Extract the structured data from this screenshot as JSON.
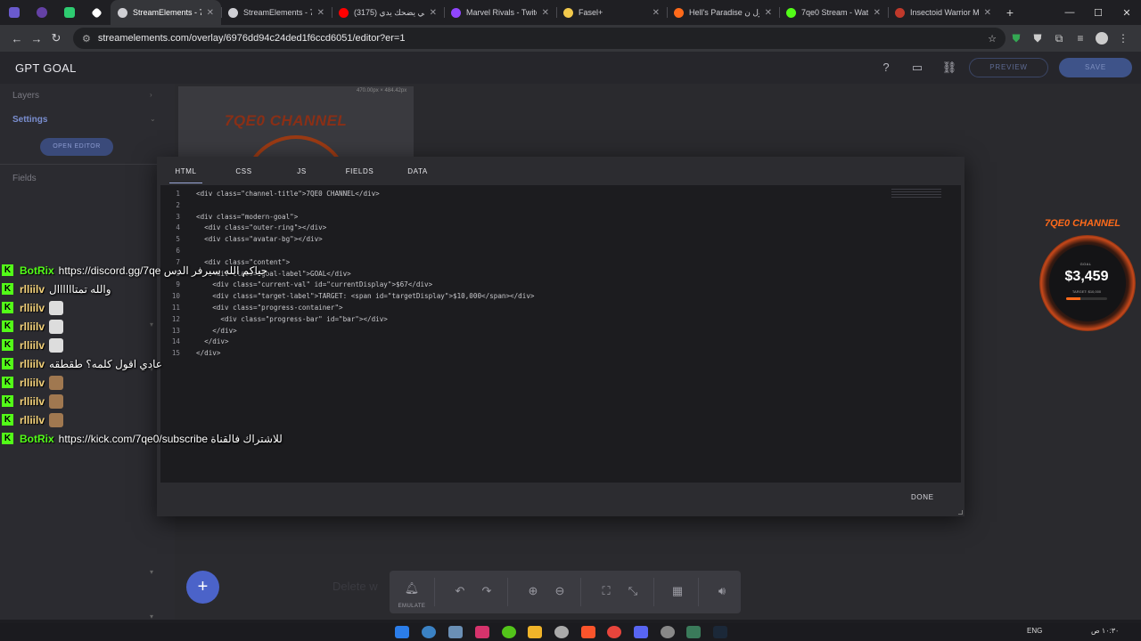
{
  "browser": {
    "tabs": [
      {
        "label": "StreamElements - 7q",
        "active": true,
        "color": "#cfcfd4"
      },
      {
        "label": "StreamElements - 7q",
        "active": false,
        "color": "#cfcfd4"
      },
      {
        "label": "(3175) الي يضحك يدي",
        "active": false,
        "color": "#ff0000"
      },
      {
        "label": "Marvel Rivals - Twitch",
        "active": false,
        "color": "#9146ff"
      },
      {
        "label": "Fasel+",
        "active": false,
        "color": "#f2c94c"
      },
      {
        "label": "Hell's Paradise رول ن",
        "active": false,
        "color": "#ff6a1a"
      },
      {
        "label": "7qe0 Stream - Watch",
        "active": false,
        "color": "#53fc18"
      },
      {
        "label": "Insectoid Warrior Me",
        "active": false,
        "color": "#c0392b"
      }
    ],
    "url": "streamelements.com/overlay/6976dd94c24ded1f6ccd6051/editor?er=1"
  },
  "header": {
    "title": "GPT GOAL",
    "preview_label": "PREVIEW",
    "save_label": "SAVE"
  },
  "left_panel": {
    "layers_label": "Layers",
    "settings_label": "Settings",
    "open_editor_label": "OPEN EDITOR",
    "fields_label": "Fields"
  },
  "canvas": {
    "overlay_title": "7QE0 CHANNEL",
    "dimensions": "470.00px × 484.42px",
    "delete_hint": "Delete w",
    "emulate_label": "EMULATE"
  },
  "preview_widget": {
    "title": "7QE0 CHANNEL",
    "goal_label": "GOAL",
    "value": "$3,459",
    "target": "TARGET: $10,000",
    "progress": 0.35
  },
  "modal": {
    "tabs": [
      "HTML",
      "CSS",
      "JS",
      "FIELDS",
      "DATA"
    ],
    "active_tab": "HTML",
    "done_label": "DONE",
    "code_lines": [
      "<div class=\"channel-title\">7QE0 CHANNEL</div>",
      "",
      "<div class=\"modern-goal\">",
      "  <div class=\"outer-ring\"></div>",
      "  <div class=\"avatar-bg\"></div>",
      "",
      "  <div class=\"content\">",
      "    <div class=\"goal-label\">GOAL</div>",
      "    <div class=\"current-val\" id=\"currentDisplay\">$67</div>",
      "    <div class=\"target-label\">TARGET: <span id=\"targetDisplay\">$10,000</span></div>",
      "    <div class=\"progress-container\">",
      "      <div class=\"progress-bar\" id=\"bar\"></div>",
      "    </div>",
      "  </div>",
      "</div>"
    ]
  },
  "chat": [
    {
      "user": "BotRix",
      "user_color": "#53fc18",
      "text": "https://discord.gg/7qe حياكم الله سيرفر الدس"
    },
    {
      "user": "rlliilv",
      "user_color": "#f4d27a",
      "text": "والله تمتاااااال"
    },
    {
      "user": "rlliilv",
      "user_color": "#f4d27a",
      "text": "",
      "emote": "#dddddd"
    },
    {
      "user": "rlliilv",
      "user_color": "#f4d27a",
      "text": "",
      "emote": "#dddddd"
    },
    {
      "user": "rlliilv",
      "user_color": "#f4d27a",
      "text": "",
      "emote": "#dddddd"
    },
    {
      "user": "rlliilv",
      "user_color": "#f4d27a",
      "text": "عادي اقول كلمه؟ طقطقه"
    },
    {
      "user": "rlliilv",
      "user_color": "#f4d27a",
      "text": "",
      "emote": "#a07850"
    },
    {
      "user": "rlliilv",
      "user_color": "#f4d27a",
      "text": "",
      "emote": "#a07850"
    },
    {
      "user": "rlliilv",
      "user_color": "#f4d27a",
      "text": "",
      "emote": "#a07850"
    },
    {
      "user": "BotRix",
      "user_color": "#53fc18",
      "text": "https://kick.com/7qe0/subscribe للاشتراك فالقناة"
    }
  ],
  "taskbar": {
    "lang": "ENG",
    "time": "١٠:٣٠ ص"
  }
}
